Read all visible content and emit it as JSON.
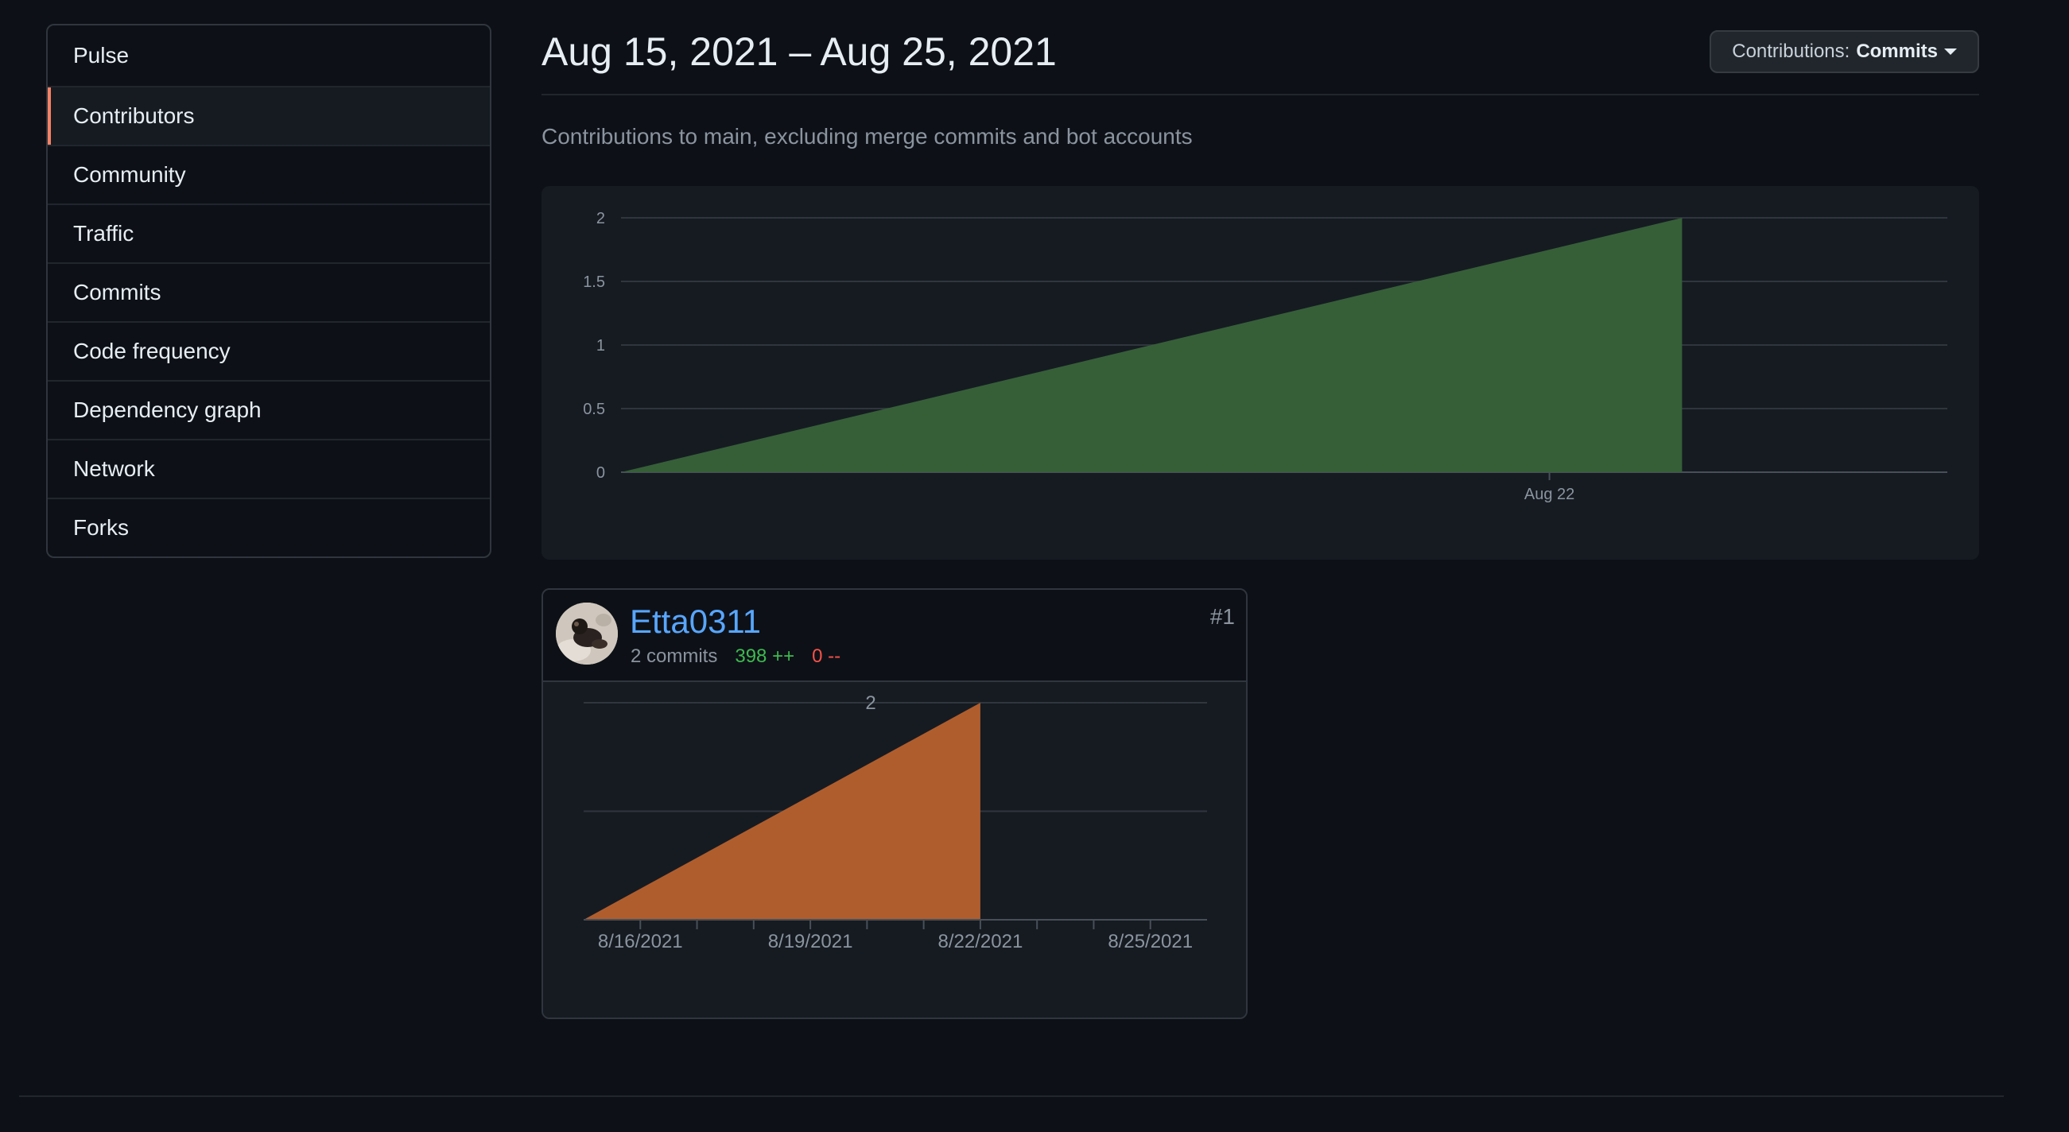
{
  "sidebar": {
    "items": [
      {
        "label": "Pulse"
      },
      {
        "label": "Contributors",
        "active": true
      },
      {
        "label": "Community"
      },
      {
        "label": "Traffic"
      },
      {
        "label": "Commits"
      },
      {
        "label": "Code frequency"
      },
      {
        "label": "Dependency graph"
      },
      {
        "label": "Network"
      },
      {
        "label": "Forks"
      }
    ]
  },
  "header": {
    "title": "Aug 15, 2021 – Aug 25, 2021",
    "dropdown_prefix": "Contributions:",
    "dropdown_value": "Commits"
  },
  "subtitle": "Contributions to main, excluding merge commits and bot accounts",
  "contributor": {
    "username": "Etta0311",
    "commits": "2 commits",
    "additions": "398 ++",
    "deletions": "0 --",
    "rank": "#1"
  },
  "colors": {
    "main_fill": "#365f38",
    "card_fill": "#b05d2d"
  },
  "chart_data": [
    {
      "type": "area",
      "x_ticks": [
        "Aug 22"
      ],
      "y_ticks": [
        "0",
        "0.5",
        "1",
        "1.5",
        "2"
      ],
      "ylim": [
        0,
        2
      ],
      "series": [
        {
          "x": [
            "Aug 15, 2021",
            "Aug 23, 2021"
          ],
          "values": [
            0,
            2
          ]
        }
      ],
      "grid": true
    },
    {
      "type": "area",
      "x_ticks": [
        "8/16/2021",
        "8/19/2021",
        "8/22/2021",
        "8/25/2021"
      ],
      "y_tick_label": "2",
      "ylim": [
        0,
        2
      ],
      "series": [
        {
          "x": [
            "8/15/2021",
            "8/22/2021"
          ],
          "values": [
            0,
            2
          ]
        }
      ],
      "grid": true
    }
  ]
}
